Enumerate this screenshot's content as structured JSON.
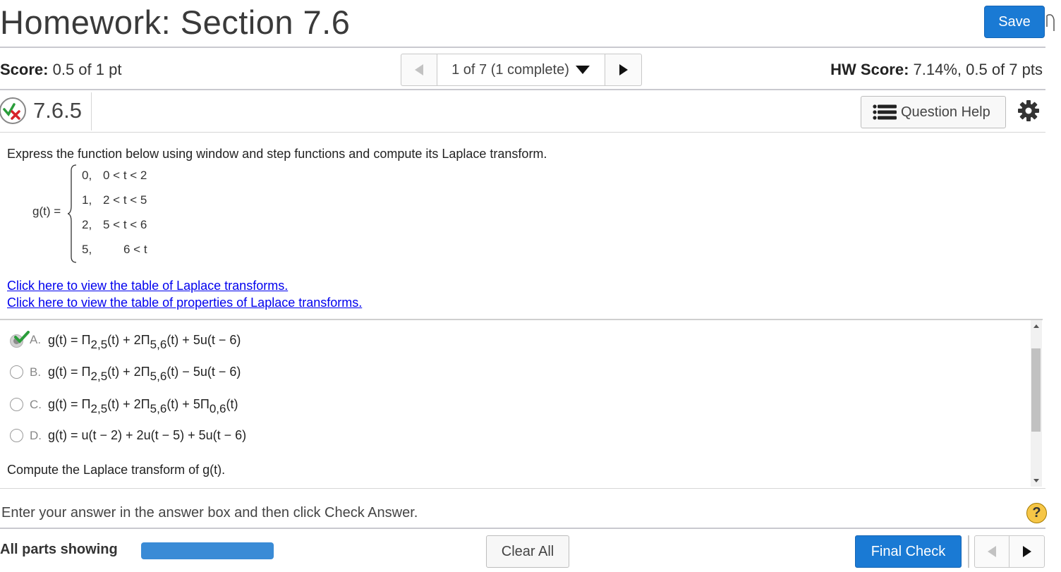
{
  "header": {
    "title": "Homework: Section 7.6",
    "save_label": "Save"
  },
  "scorebar": {
    "score_label": "Score:",
    "score_value": " 0.5 of 1 pt",
    "nav_text": "1 of 7 (1 complete)",
    "hw_score_label": "HW Score:",
    "hw_score_value": " 7.14%, 0.5 of 7 pts"
  },
  "question": {
    "number": "7.6.5",
    "help_label": "Question Help",
    "prompt": "Express the function below using window and step functions and compute its Laplace transform.",
    "function_label": "g(t) =",
    "cases": [
      {
        "value": "0,",
        "condition": "0 < t < 2"
      },
      {
        "value": "1,",
        "condition": "2 < t < 5"
      },
      {
        "value": "2,",
        "condition": "5 < t < 6"
      },
      {
        "value": "5,",
        "condition": "6 < t"
      }
    ],
    "links": [
      "Click here to view the table of Laplace transforms.",
      "Click here to view the table of properties of Laplace transforms."
    ],
    "options": [
      {
        "letter": "A.",
        "selected": true,
        "correct": true
      },
      {
        "letter": "B.",
        "selected": false
      },
      {
        "letter": "C.",
        "selected": false
      },
      {
        "letter": "D.",
        "selected": false
      }
    ],
    "compute_prompt": "Compute the Laplace transform of g(t)."
  },
  "footer": {
    "instruction": "Enter your answer in the answer box and then click Check Answer.",
    "help_symbol": "?",
    "all_parts": "All parts showing",
    "clear_label": "Clear All",
    "final_label": "Final Check"
  },
  "colors": {
    "accent": "#1a7ad4",
    "link": "#0000ee",
    "progress": "#3a8bd6",
    "correct": "#2a9d3a",
    "incorrect": "#d8232a"
  }
}
